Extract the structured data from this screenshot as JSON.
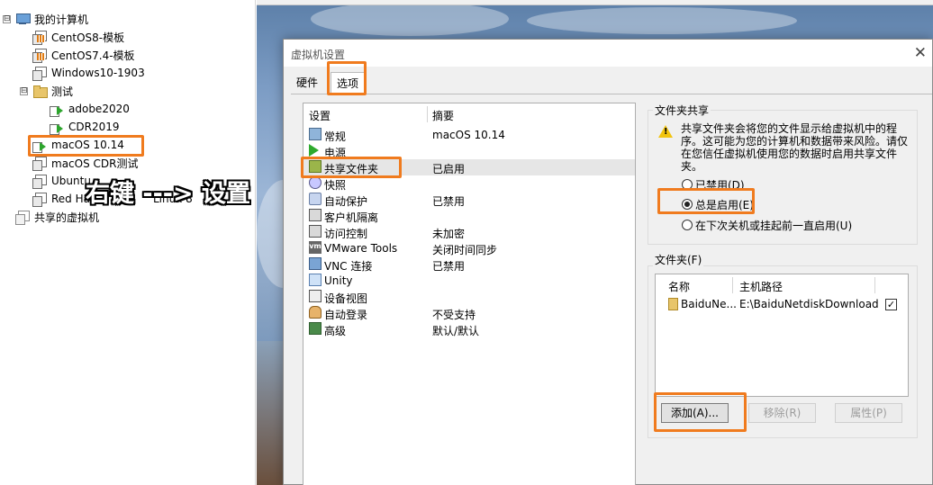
{
  "tree": {
    "root": "我的计算机",
    "items": [
      {
        "label": "CentOS8-模板"
      },
      {
        "label": "CentOS7.4-模板"
      },
      {
        "label": "Windows10-1903"
      },
      {
        "label": "测试"
      },
      {
        "label": "adobe2020"
      },
      {
        "label": "CDR2019"
      },
      {
        "label": "macOS 10.14"
      },
      {
        "label": "macOS CDR测试"
      },
      {
        "label": "Ubuntu"
      },
      {
        "label": "Red Hat"
      },
      {
        "label": "Linux 8"
      }
    ],
    "shared": "共享的虚拟机",
    "toggle_open": "⊟",
    "toggle_symbol": "⊟"
  },
  "annotation": {
    "text": "右键 ---> 设置",
    "color": "#ffffff"
  },
  "dialog": {
    "title": "虚拟机设置",
    "close": "✕",
    "tabs": [
      "硬件",
      "选项"
    ],
    "list_header": [
      "设置",
      "摘要"
    ],
    "rows": [
      {
        "name": "常规",
        "summary": "macOS 10.14",
        "icon": "monitor-icon"
      },
      {
        "name": "电源",
        "summary": "",
        "icon": "power-play-icon"
      },
      {
        "name": "共享文件夹",
        "summary": "已启用",
        "icon": "shared-folder-icon"
      },
      {
        "name": "快照",
        "summary": "",
        "icon": "snapshot-icon"
      },
      {
        "name": "自动保护",
        "summary": "已禁用",
        "icon": "autoprotect-icon"
      },
      {
        "name": "客户机隔离",
        "summary": "",
        "icon": "isolation-icon"
      },
      {
        "name": "访问控制",
        "summary": "未加密",
        "icon": "lock-icon"
      },
      {
        "name": "VMware Tools",
        "summary": "关闭时间同步",
        "icon": "vmware-tools-icon"
      },
      {
        "name": "VNC 连接",
        "summary": "已禁用",
        "icon": "vnc-icon"
      },
      {
        "name": "Unity",
        "summary": "",
        "icon": "unity-icon"
      },
      {
        "name": "设备视图",
        "summary": "",
        "icon": "device-view-icon"
      },
      {
        "name": "自动登录",
        "summary": "不受支持",
        "icon": "autologin-icon"
      },
      {
        "name": "高级",
        "summary": "默认/默认",
        "icon": "advanced-icon"
      }
    ],
    "vm_badge": "vm",
    "share_group": {
      "label": "文件夹共享",
      "warning": "共享文件夹会将您的文件显示给虚拟机中的程序。这可能为您的计算机和数据带来风险。请仅在您信任虚拟机使用您的数据时启用共享文件夹。",
      "warning_mark": "!",
      "options": [
        {
          "label": "已禁用(D)",
          "selected": false
        },
        {
          "label": "总是启用(E)",
          "selected": true
        },
        {
          "label": "在下次关机或挂起前一直启用(U)",
          "selected": false
        }
      ]
    },
    "folders_group": {
      "label": "文件夹(F)",
      "columns": [
        "名称",
        "主机路径"
      ],
      "rows": [
        {
          "name": "BaiduNe...",
          "path": "E:\\BaiduNetdiskDownload",
          "checked": "✓"
        }
      ]
    },
    "buttons": {
      "add": "添加(A)...",
      "remove": "移除(R)",
      "properties": "属性(P)"
    }
  },
  "colors": {
    "highlight": "#f07b1e",
    "selected_row": "#e6e6e6"
  }
}
